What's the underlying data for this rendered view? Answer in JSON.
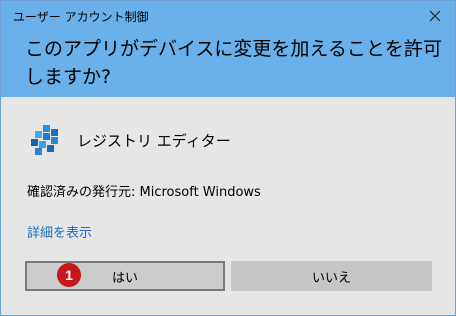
{
  "dialog": {
    "title": "ユーザー アカウント制御",
    "question": "このアプリがデバイスに変更を加えることを許可しますか?",
    "app_name": "レジストリ エディター",
    "publisher_line": "確認済みの発行元: Microsoft Windows",
    "details_link": "詳細を表示"
  },
  "buttons": {
    "yes": "はい",
    "no": "いいえ"
  },
  "annotation": {
    "step_number": "1"
  },
  "colors": {
    "header": "#6ab0ea",
    "body": "#e6e6e6",
    "link": "#1a6fc0",
    "badge": "#c8161d"
  },
  "icons": {
    "close": "close-icon",
    "app": "registry-editor-icon"
  }
}
